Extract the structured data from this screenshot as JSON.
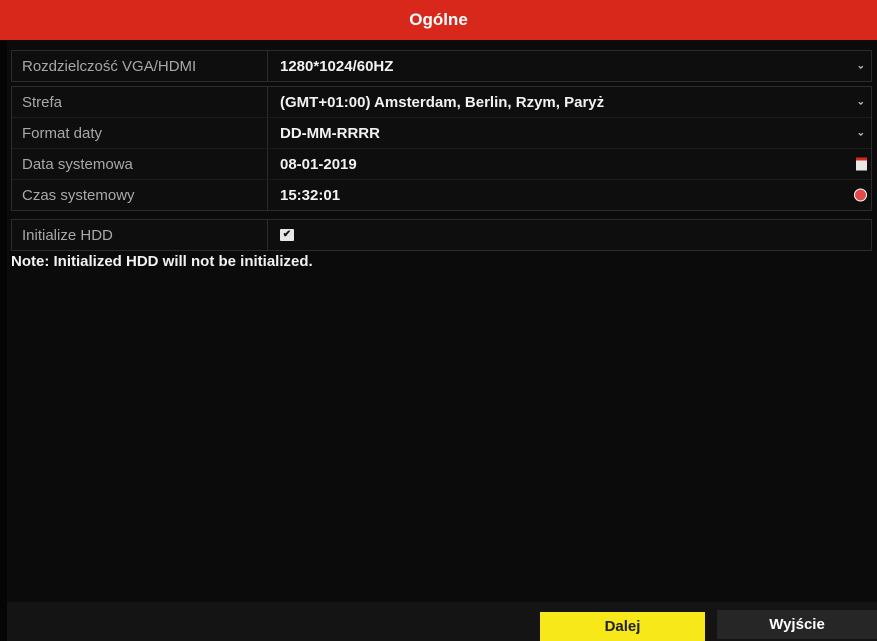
{
  "window": {
    "title": "Ogólne"
  },
  "settings": {
    "resolution": {
      "label": "Rozdzielczość VGA/HDMI",
      "value": "1280*1024/60HZ"
    },
    "timezone": {
      "label": "Strefa",
      "value": "(GMT+01:00) Amsterdam, Berlin, Rzym, Paryż"
    },
    "date_format": {
      "label": "Format daty",
      "value": "DD-MM-RRRR"
    },
    "system_date": {
      "label": "Data systemowa",
      "value": "08-01-2019"
    },
    "system_time": {
      "label": "Czas systemowy",
      "value": "15:32:01"
    },
    "init_hdd": {
      "label": "Initialize HDD",
      "checked": true
    }
  },
  "note": "Note: Initialized HDD will not be initialized.",
  "buttons": {
    "next": "Dalej",
    "exit": "Wyjście"
  },
  "colors": {
    "title_bar": "#d7281b",
    "next_button": "#f6e819"
  },
  "icons": {
    "dropdown": "chevron-down-icon",
    "date": "calendar-icon",
    "time": "clock-icon",
    "checkbox": "checkbox-checked-icon"
  }
}
